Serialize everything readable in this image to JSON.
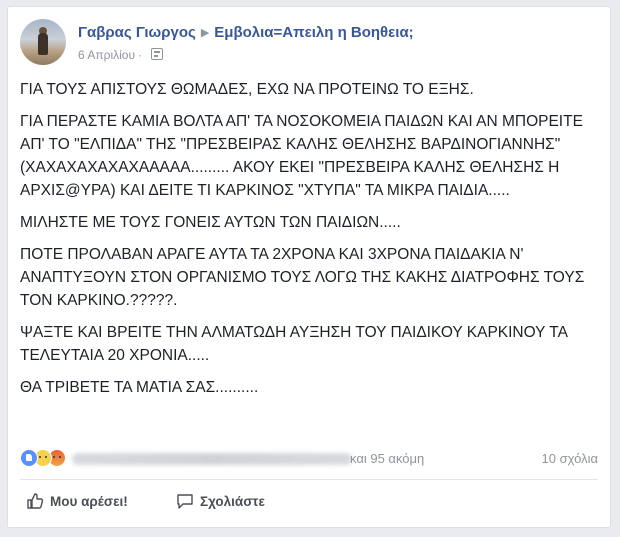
{
  "post": {
    "author": "Γαβρας Γιωργος",
    "group": "Εμβολια=Απειλη η Βοηθεια;",
    "date": "6 Απριλίου",
    "separator": "·",
    "paragraphs": [
      "ΓΙΑ ΤΟΥΣ ΑΠΙΣΤΟΥΣ ΘΩΜΑΔΕΣ, ΕΧΩ ΝΑ ΠΡΟΤΕΙΝΩ ΤΟ ΕΞΗΣ.",
      "ΓΙΑ ΠΕΡΑΣΤΕ ΚΑΜΙΑ ΒΟΛΤΑ ΑΠ' ΤΑ ΝΟΣΟΚΟΜΕΙΑ ΠΑΙΔΩΝ ΚΑΙ ΑΝ ΜΠΟΡΕΙΤΕ ΑΠ' ΤΟ \"ΕΛΠΙΔΑ\" ΤΗΣ \"ΠΡΕΣΒΕΙΡΑΣ ΚΑΛΗΣ ΘΕΛΗΣΗΣ ΒΑΡΔΙΝΟΓΙΑΝΝΗΣ\" (ΧΑΧΑΧΑΧΑΧΑΧΑΑΑΑΑ......... ΑΚΟΥ ΕΚΕΙ \"ΠΡΕΣΒΕΙΡΑ ΚΑΛΗΣ ΘΕΛΗΣΗΣ Η ΑΡΧΙΣ@ΥΡΑ) ΚΑΙ ΔΕΙΤΕ ΤΙ ΚΑΡΚΙΝΟΣ \"ΧΤΥΠΑ\" ΤΑ ΜΙΚΡΑ ΠΑΙΔΙΑ.....",
      "ΜΙΛΗΣΤΕ ΜΕ ΤΟΥΣ ΓΟΝΕΙΣ ΑΥΤΩΝ ΤΩΝ ΠΑΙΔΙΩΝ.....",
      "ΠΟΤΕ ΠΡΟΛΑΒΑΝ ΑΡΑΓΕ ΑΥΤΑ ΤΑ 2ΧΡΟΝΑ ΚΑΙ 3ΧΡΟΝΑ ΠΑΙΔΑΚΙΑ Ν' ΑΝΑΠΤΥΞΟΥΝ ΣΤΟΝ ΟΡΓΑΝΙΣΜΟ ΤΟΥΣ ΛΟΓΩ ΤΗΣ ΚΑΚΗΣ ΔΙΑΤΡΟΦΗΣ ΤΟΥΣ ΤΟΝ ΚΑΡΚΙΝΟ.?????.",
      "ΨΑΞΤΕ ΚΑΙ ΒΡΕΙΤΕ ΤΗΝ ΑΛΜΑΤΩΔΗ ΑΥΞΗΣΗ ΤΟΥ ΠΑΙΔΙΚΟΥ ΚΑΡΚΙΝΟΥ ΤΑ ΤΕΛΕΥΤΑΙΑ 20 ΧΡΟΝΙΑ.....",
      "ΘΑ ΤΡΙΒΕΤΕ ΤΑ ΜΑΤΙΑ ΣΑΣ.........."
    ]
  },
  "stats": {
    "reactions_others": "και 95 ακόμη",
    "comments": "10 σχόλια",
    "reaction_icons": [
      "like-reaction-icon",
      "sad-reaction-icon",
      "angry-reaction-icon"
    ]
  },
  "actions": {
    "like_label": "Μου αρέσει!",
    "comment_label": "Σχολιάστε"
  },
  "colors": {
    "link": "#365899",
    "meta": "#90949c",
    "like_blue": "#5890ff"
  }
}
